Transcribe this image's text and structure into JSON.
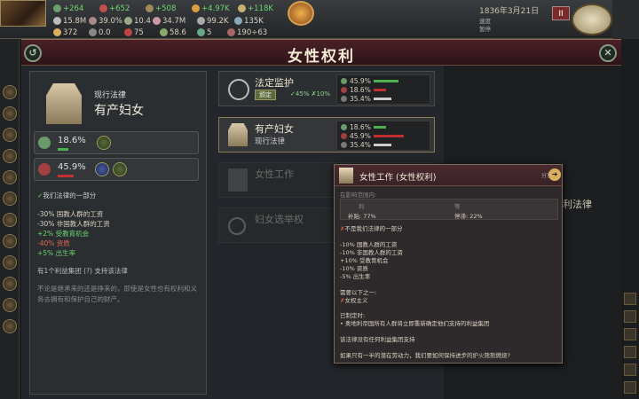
{
  "topbar": {
    "row1": [
      "+264",
      "+652",
      "+508",
      "+4.97K",
      "+118K"
    ],
    "row2": [
      "15.8M",
      "39.0%",
      "10.4",
      "34.7M",
      "99.2K",
      "135K"
    ],
    "row3": [
      "372",
      "0.0",
      "75",
      "58.6",
      "5",
      "190÷63"
    ],
    "date": "1836年3月21日",
    "date_sub": "速度",
    "date_sub2": "暂停",
    "pause_label": "II"
  },
  "header": {
    "title": "女性权利",
    "back": "↺",
    "close": "✕"
  },
  "detail": {
    "current_label": "现行法律",
    "current_name": "有产妇女",
    "ig1_pct": "18.6%",
    "ig2_pct": "45.9%",
    "is_part": "我们法律的一部分",
    "effects": [
      {
        "text": "-30% 国教人群的工资",
        "color": "#e8e0d0"
      },
      {
        "text": "-30% 非国教人群的工资",
        "color": "#e8e0d0"
      },
      {
        "text": "+2% 受教育机会",
        "color": "#6fd36f"
      },
      {
        "text": "-40% 资质",
        "color": "#e06050"
      },
      {
        "text": "+5% 出生率",
        "color": "#6fd36f"
      }
    ],
    "support_text": "有1个利益集团 (?) 支持该法律",
    "description": "不论是继承来的还是挣来的，即使是女性也有权利和义务去拥有和保护自己的财产。"
  },
  "laws": [
    {
      "title": "法定监护",
      "enact": "颁定",
      "enact_extra": "✓45% ✗10%",
      "stats": [
        "45.9%",
        "18.6%",
        "35.4%"
      ],
      "bar_colors": [
        "#4caf50",
        "#c03030",
        "#cccccc"
      ]
    },
    {
      "title": "有产妇女",
      "sub": "现行法律",
      "stats": [
        "18.6%",
        "45.9%",
        "35.4%"
      ],
      "bar_colors": [
        "#4caf50",
        "#c03030",
        "#cccccc"
      ]
    },
    {
      "title": "女性工作"
    },
    {
      "title": "妇女选举权"
    }
  ],
  "tooltip": {
    "title": "女性工作 (女性权利)",
    "tag": "分享",
    "arrow": "➜",
    "line_cur": "在影响范围内:",
    "box_l1": "利",
    "box_r1": "等",
    "box_l2": "补贴: 77%",
    "box_r2": "停滞: 22%",
    "not_part": "不是我们法律的一部分",
    "effects": [
      {
        "text": "-10% 国教人群的工资",
        "color": "#e8e0d0"
      },
      {
        "text": "-10% 非国教人群的工资",
        "color": "#e8e0d0"
      },
      {
        "text": "+10% 受教育机会",
        "color": "#6fd36f"
      },
      {
        "text": "-10% 资质",
        "color": "#e06050"
      },
      {
        "text": "-5% 出生率",
        "color": "#e06050"
      }
    ],
    "requires": "需要以下之一:",
    "req_item": "女权主义",
    "enacted": "已制定时:",
    "enacted_item": "• 奥地利帝国所有人群将立即重新确定他们支持的利益集团",
    "no_support": "该法律没有任何利益集团支持",
    "quote": "如果只有一半的潜在劳动力，我们要如何保持进步的炉火熊熊燃烧?"
  },
  "right_text": "利法律"
}
